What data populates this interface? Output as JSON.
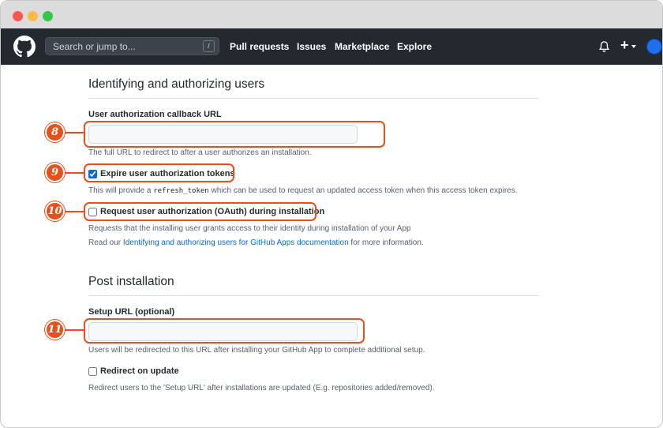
{
  "window": {
    "buttons": [
      "close",
      "minimize",
      "maximize"
    ]
  },
  "nav": {
    "search_placeholder": "Search or jump to...",
    "search_shortcut": "/",
    "links": [
      "Pull requests",
      "Issues",
      "Marketplace",
      "Explore"
    ],
    "plus_label": "+",
    "icons": [
      "github-logo-icon",
      "bell-icon",
      "plus-icon",
      "caret-down-icon",
      "avatar"
    ]
  },
  "sections": {
    "identify": {
      "heading": "Identifying and authorizing users",
      "callback_label": "User authorization callback URL",
      "callback_value": "",
      "callback_help": "The full URL to redirect to after a user authorizes an installation.",
      "expire_label": "Expire user authorization tokens",
      "expire_checked": true,
      "expire_help_pre": "This will provide a ",
      "expire_help_code": "refresh_token",
      "expire_help_post": " which can be used to request an updated access token when this access token expires.",
      "oauth_label": "Request user authorization (OAuth) during installation",
      "oauth_checked": false,
      "oauth_help": "Requests that the installing user grants access to their identity during installation of your App",
      "readmore_pre": "Read our ",
      "readmore_link": "Identifying and authorizing users for GitHub Apps documentation",
      "readmore_post": " for more information."
    },
    "post_install": {
      "heading": "Post installation",
      "setup_label": "Setup URL (optional)",
      "setup_value": "",
      "setup_help": "Users will be redirected to this URL after installing your GitHub App to complete additional setup.",
      "redirect_label": "Redirect on update",
      "redirect_checked": false,
      "redirect_help": "Redirect users to the 'Setup URL' after installations are updated (E.g. repositories added/removed)."
    }
  },
  "callouts": {
    "colors": {
      "accent": "#e4511b"
    },
    "markers": [
      "8",
      "9",
      "10",
      "11"
    ]
  }
}
